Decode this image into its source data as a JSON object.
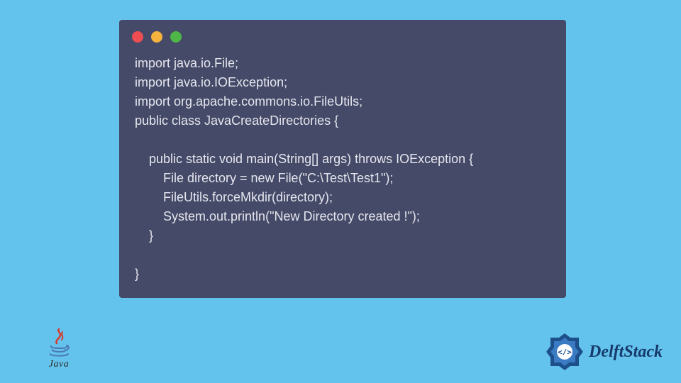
{
  "code": {
    "lines": [
      "import java.io.File;",
      "import java.io.IOException;",
      "import org.apache.commons.io.FileUtils;",
      "public class JavaCreateDirectories {",
      "",
      "    public static void main(String[] args) throws IOException {",
      "        File directory = new File(\"C:\\Test\\Test1\");",
      "        FileUtils.forceMkdir(directory);",
      "        System.out.println(\"New Directory created !\");",
      "    }",
      "",
      "}"
    ]
  },
  "logos": {
    "java_label": "Java",
    "delft_label": "DelftStack"
  },
  "window": {
    "dot_red": "#ee4e52",
    "dot_yellow": "#f3b33e",
    "dot_green": "#4fb748"
  }
}
